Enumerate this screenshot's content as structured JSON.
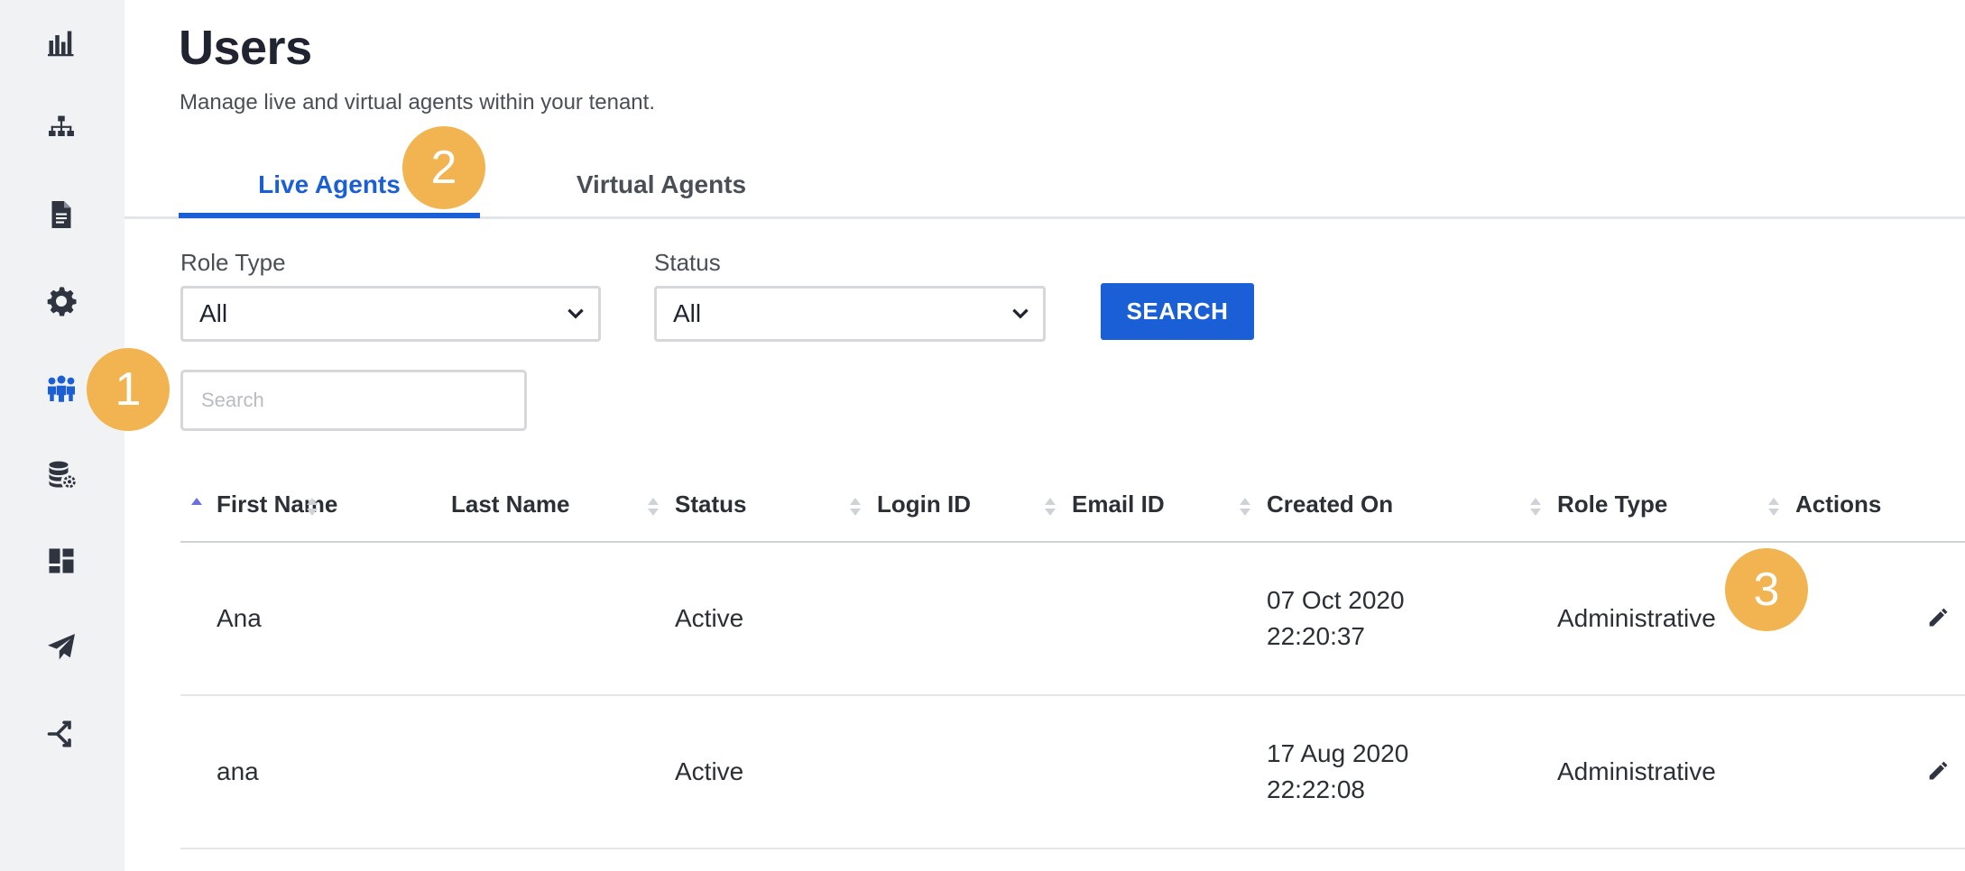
{
  "page": {
    "title": "Users",
    "subtitle": "Manage live and virtual agents within your tenant."
  },
  "sidebar": {
    "items": [
      {
        "icon": "bar-chart-icon",
        "active": false
      },
      {
        "icon": "org-chart-icon",
        "active": false
      },
      {
        "icon": "document-icon",
        "active": false
      },
      {
        "icon": "gear-icon",
        "active": false
      },
      {
        "icon": "users-icon",
        "active": true
      },
      {
        "icon": "database-settings-icon",
        "active": false
      },
      {
        "icon": "dashboard-icon",
        "active": false
      },
      {
        "icon": "paper-plane-icon",
        "active": false
      },
      {
        "icon": "merge-icon",
        "active": false
      }
    ]
  },
  "tabs": [
    {
      "label": "Live Agents",
      "active": true
    },
    {
      "label": "Virtual Agents",
      "active": false
    }
  ],
  "filters": {
    "role_type": {
      "label": "Role Type",
      "value": "All"
    },
    "status": {
      "label": "Status",
      "value": "All"
    },
    "search_button": "SEARCH",
    "search_placeholder": "Search"
  },
  "table": {
    "columns": [
      "First Name",
      "Last Name",
      "Status",
      "Login ID",
      "Email ID",
      "Created On",
      "Role Type",
      "Actions"
    ],
    "rows": [
      {
        "first_name": "Ana",
        "last_name": "",
        "status": "Active",
        "login_id": "",
        "email_id": "",
        "created_date": "07 Oct 2020",
        "created_time": "22:20:37",
        "role_type": "Administrative"
      },
      {
        "first_name": "ana",
        "last_name": "",
        "status": "Active",
        "login_id": "",
        "email_id": "",
        "created_date": "17 Aug 2020",
        "created_time": "22:22:08",
        "role_type": "Administrative"
      }
    ]
  },
  "callouts": [
    "1",
    "2",
    "3"
  ],
  "colors": {
    "accent": "#1b5fd6",
    "callout": "#f2b451",
    "sidebar_bg": "#f1f2f4",
    "icon_default": "#2f3540"
  }
}
